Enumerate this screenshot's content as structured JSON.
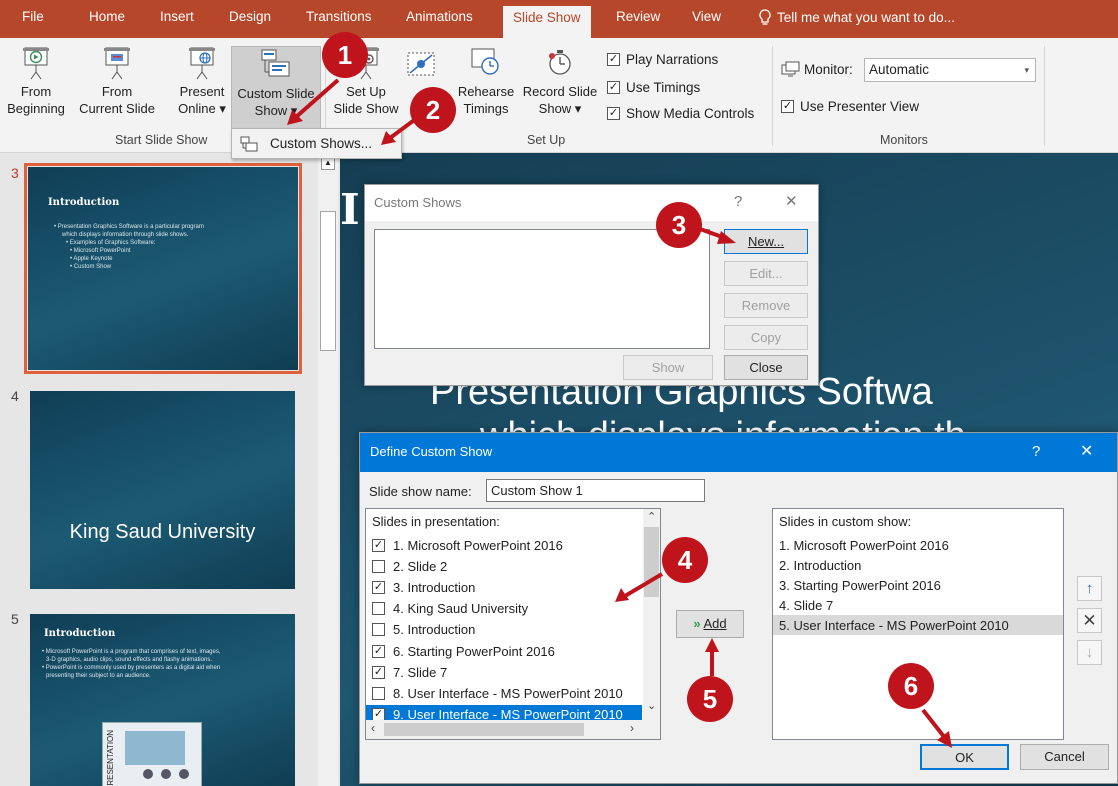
{
  "ribbon": {
    "tabs": [
      "File",
      "Home",
      "Insert",
      "Design",
      "Transitions",
      "Animations",
      "Slide Show",
      "Review",
      "View",
      "Tell me what you want to do..."
    ],
    "active_tab": "Slide Show",
    "buttons": {
      "from_beginning": [
        "From",
        "Beginning"
      ],
      "from_current": [
        "From",
        "Current Slide"
      ],
      "present_online": [
        "Present",
        "Online ▾"
      ],
      "custom_slide_show": [
        "Custom Slide",
        "Show ▾"
      ],
      "set_up": [
        "Set Up",
        "Slide Show"
      ],
      "rehearse": [
        "Rehearse",
        "Timings"
      ],
      "record": [
        "Record Slide",
        "Show ▾"
      ]
    },
    "checks": {
      "play_narrations": "Play Narrations",
      "use_timings": "Use Timings",
      "show_media": "Show Media Controls",
      "presenter_view": "Use Presenter View"
    },
    "monitor_label": "Monitor:",
    "monitor_value": "Automatic",
    "groups": {
      "start": "Start Slide Show",
      "setup": "Set Up",
      "monitors": "Monitors"
    },
    "dropdown_item": "Custom Shows..."
  },
  "thumbnails": [
    {
      "num": "3",
      "title": "Introduction",
      "lines": [
        "• Presentation Graphics Software is a particular program",
        "which displays information through slide shows.",
        "• Examples of Graphics Software:",
        "• Microsoft PowerPoint",
        "• Apple Keynote",
        "• Custom Show"
      ]
    },
    {
      "num": "4",
      "title": "King Saud University"
    },
    {
      "num": "5",
      "title": "Introduction",
      "lines": [
        "• Microsoft PowerPoint is a program that comprises of text, images,",
        "3-D graphics, audio clips, sound effects and flashy animations.",
        "• PowerPoint is commonly used by presenters as a digital aid when",
        "presenting their subject to an audience."
      ],
      "image_label": "PRESENTATION"
    }
  ],
  "editor": {
    "title_char": "I",
    "text1": "Presentation Graphics Softwa",
    "text2": "which displays information th"
  },
  "custom_shows": {
    "title": "Custom Shows",
    "help": "?",
    "close": "✕",
    "buttons": {
      "new": "New...",
      "edit": "Edit...",
      "remove": "Remove",
      "copy": "Copy",
      "show": "Show",
      "close": "Close"
    }
  },
  "define": {
    "title": "Define Custom Show",
    "help": "?",
    "close": "✕",
    "name_label": "Slide show name:",
    "name_value": "Custom Show 1",
    "left_header": "Slides in presentation:",
    "slides": [
      {
        "label": "1. Microsoft PowerPoint 2016",
        "checked": true
      },
      {
        "label": "2. Slide 2",
        "checked": false
      },
      {
        "label": "3. Introduction",
        "checked": true
      },
      {
        "label": "4. King Saud University",
        "checked": false
      },
      {
        "label": "5. Introduction",
        "checked": false
      },
      {
        "label": "6. Starting PowerPoint 2016",
        "checked": true
      },
      {
        "label": "7. Slide 7",
        "checked": true
      },
      {
        "label": "8. User Interface - MS PowerPoint 2010",
        "checked": false
      },
      {
        "label": "9. User Interface - MS PowerPoint 2010",
        "checked": true,
        "selected": true
      }
    ],
    "add_label": "Add",
    "right_header": "Slides in custom show:",
    "custom_slides": [
      "1. Microsoft PowerPoint 2016",
      "2. Introduction",
      "3. Starting PowerPoint 2016",
      "4. Slide 7",
      "5. User Interface - MS PowerPoint 2010"
    ],
    "selected_custom_index": 4,
    "ok": "OK",
    "cancel": "Cancel"
  },
  "markers": [
    "1",
    "2",
    "3",
    "4",
    "5",
    "6"
  ],
  "colors": {
    "accent": "#b7472a",
    "marker": "#c0141c",
    "selection": "#0078d7"
  }
}
